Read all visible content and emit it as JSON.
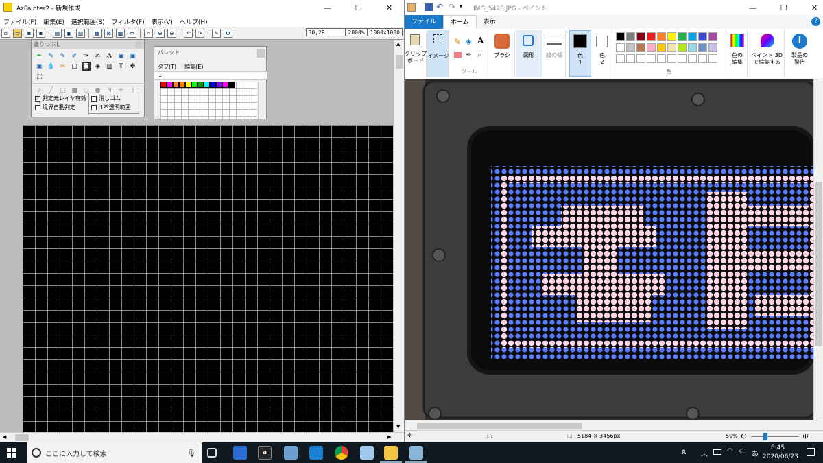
{
  "azpainter": {
    "title": "AzPainter2 - 新規作成",
    "menu": [
      "ファイル(F)",
      "編集(E)",
      "選択範囲(S)",
      "フィルタ(F)",
      "表示(V)",
      "ヘルプ(H)"
    ],
    "status": {
      "coords": "30,29",
      "zoom": "2000%",
      "size": "1000x1000"
    },
    "fill_panel": {
      "title": "塗りつぶし",
      "check1": "判定元レイヤ有効",
      "check2": "境界自動判定",
      "check3": "消しゴム",
      "check4": "↑不透明範囲",
      "check1_state": "✓"
    },
    "palette_panel": {
      "title": "パレット",
      "tab": "タブ(T)",
      "edit": "編集(E)",
      "tab_index": "1",
      "colors": [
        "#ff0000",
        "#ff00ff",
        "#ff8040",
        "#ff8000",
        "#ffff00",
        "#00ff00",
        "#00a000",
        "#00ffff",
        "#0000ff",
        "#8000ff",
        "#ff00ff",
        "#000000"
      ]
    }
  },
  "paint": {
    "title": "IMG_5428.JPG - ペイント",
    "tabs": {
      "file": "ファイル",
      "home": "ホーム",
      "view": "表示"
    },
    "ribbon": {
      "clipboard": "クリップ\nボード",
      "image": "イメージ",
      "tools_label": "ツール",
      "brush": "ブラシ",
      "shapes": "図形",
      "line_width": "線の幅",
      "color1": "色\n1",
      "color2": "色\n2",
      "colors_label": "色",
      "edit_colors": "色の\n編集",
      "paint3d": "ペイント 3D\nで編集する",
      "product_alert": "製品の\n警告"
    },
    "palette": [
      "#000000",
      "#7f7f7f",
      "#880015",
      "#ed1c24",
      "#ff7f27",
      "#fff200",
      "#22b14c",
      "#00a2e8",
      "#3f48cc",
      "#a349a4",
      "#ffffff",
      "#c3c3c3",
      "#b97a57",
      "#ffaec9",
      "#ffc90e",
      "#efe4b0",
      "#b5e61d",
      "#99d9ea",
      "#7092be",
      "#c8bfe7"
    ],
    "status": {
      "dimensions": "5184 × 3456px",
      "zoom": "50%"
    }
  },
  "taskbar": {
    "search_placeholder": "ここに入力して検索",
    "time": "8:45",
    "date": "2020/06/23",
    "ime": "あ"
  }
}
